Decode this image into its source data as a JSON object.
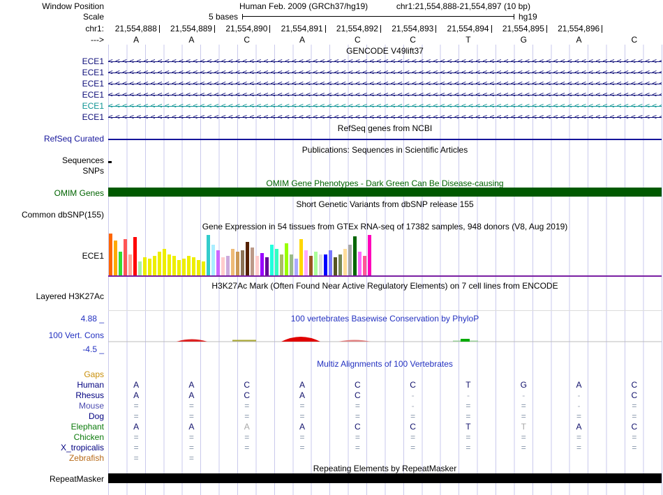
{
  "header": {
    "window_position_label": "Window Position",
    "assembly_title": "Human Feb. 2009 (GRCh37/hg19)",
    "position_text": "chr1:21,554,888-21,554,897 (10 bp)",
    "scale_label": "Scale",
    "scale_value": "5 bases",
    "scale_assembly": "hg19",
    "chrom_label": "chr1:",
    "strand_label": "--->",
    "coordinates": [
      "21,554,888",
      "21,554,889",
      "21,554,890",
      "21,554,891",
      "21,554,892",
      "21,554,893",
      "21,554,894",
      "21,554,895",
      "21,554,896"
    ],
    "bases": [
      "A",
      "A",
      "C",
      "A",
      "C",
      "C",
      "T",
      "G",
      "A",
      "C"
    ]
  },
  "tracks": {
    "gencode": {
      "title": "GENCODE V49lift37",
      "arrow_char": "<",
      "genes": [
        {
          "label": "ECE1",
          "color": "#0c0c78"
        },
        {
          "label": "ECE1",
          "color": "#0c0c78"
        },
        {
          "label": "ECE1",
          "color": "#0c0c78"
        },
        {
          "label": "ECE1",
          "color": "#0c0c78"
        },
        {
          "label": "ECE1",
          "color": "#0d9494"
        },
        {
          "label": "ECE1",
          "color": "#0c0c78"
        }
      ]
    },
    "refseq": {
      "title": "RefSeq genes from NCBI",
      "label": "RefSeq Curated",
      "color": "#15159b"
    },
    "publications": {
      "title": "Publications: Sequences in Scientific Articles",
      "label": "Sequences"
    },
    "snps": {
      "label": "SNPs"
    },
    "omim": {
      "title": "OMIM Gene Phenotypes - Dark Green Can Be Disease-causing",
      "label": "OMIM Genes",
      "bar_color": "#005900",
      "text_color": "#006400"
    },
    "dbsnp": {
      "title": "Short Genetic Variants from dbSNP release 155",
      "label": "Common dbSNP(155)"
    },
    "gtex": {
      "title": "Gene Expression in 54 tissues from GTEx RNA-seq of 17382 samples, 948 donors (V8, Aug 2019)",
      "label": "ECE1",
      "baseline_color": "#7a1fa2",
      "bars": [
        {
          "c": "#FF6600",
          "h": 60
        },
        {
          "c": "#FFAA00",
          "h": 50
        },
        {
          "c": "#33DD33",
          "h": 34
        },
        {
          "c": "#FF5555",
          "h": 52
        },
        {
          "c": "#FFAA99",
          "h": 30
        },
        {
          "c": "#FF0000",
          "h": 55
        },
        {
          "c": "#AAEEAA",
          "h": 20
        },
        {
          "c": "#EEEE00",
          "h": 26
        },
        {
          "c": "#EEEE00",
          "h": 24
        },
        {
          "c": "#EEEE00",
          "h": 28
        },
        {
          "c": "#EEEE00",
          "h": 34
        },
        {
          "c": "#EEEE00",
          "h": 38
        },
        {
          "c": "#EEEE00",
          "h": 30
        },
        {
          "c": "#EEEE00",
          "h": 28
        },
        {
          "c": "#EEEE00",
          "h": 22
        },
        {
          "c": "#EEEE00",
          "h": 24
        },
        {
          "c": "#EEEE00",
          "h": 28
        },
        {
          "c": "#EEEE00",
          "h": 26
        },
        {
          "c": "#EEEE00",
          "h": 22
        },
        {
          "c": "#EEEE00",
          "h": 20
        },
        {
          "c": "#33CCCC",
          "h": 58
        },
        {
          "c": "#AAEEFF",
          "h": 44
        },
        {
          "c": "#CC66FF",
          "h": 36
        },
        {
          "c": "#FFCCCC",
          "h": 26
        },
        {
          "c": "#CCAADD",
          "h": 28
        },
        {
          "c": "#EEBB77",
          "h": 38
        },
        {
          "c": "#CC9955",
          "h": 34
        },
        {
          "c": "#8B7355",
          "h": 36
        },
        {
          "c": "#552200",
          "h": 48
        },
        {
          "c": "#BB9988",
          "h": 40
        },
        {
          "c": "#FFCCCC",
          "h": 28
        },
        {
          "c": "#9900FF",
          "h": 32
        },
        {
          "c": "#660099",
          "h": 26
        },
        {
          "c": "#22FFDD",
          "h": 44
        },
        {
          "c": "#33FFC2",
          "h": 38
        },
        {
          "c": "#AABB66",
          "h": 30
        },
        {
          "c": "#99FF00",
          "h": 46
        },
        {
          "c": "#99BB88",
          "h": 30
        },
        {
          "c": "#AAAAFF",
          "h": 24
        },
        {
          "c": "#FFD700",
          "h": 52
        },
        {
          "c": "#FFAAFF",
          "h": 36
        },
        {
          "c": "#995522",
          "h": 28
        },
        {
          "c": "#AAFF99",
          "h": 34
        },
        {
          "c": "#DDDDDD",
          "h": 30
        },
        {
          "c": "#0000FF",
          "h": 30
        },
        {
          "c": "#7777FF",
          "h": 36
        },
        {
          "c": "#555522",
          "h": 26
        },
        {
          "c": "#778855",
          "h": 30
        },
        {
          "c": "#FFDD99",
          "h": 38
        },
        {
          "c": "#AAAAAA",
          "h": 44
        },
        {
          "c": "#006600",
          "h": 56
        },
        {
          "c": "#FF66FF",
          "h": 34
        },
        {
          "c": "#FF5599",
          "h": 28
        },
        {
          "c": "#FF00BB",
          "h": 58
        }
      ]
    },
    "h3k27ac": {
      "title": "H3K27Ac Mark (Often Found Near Active Regulatory Elements) on 7 cell lines from ENCODE",
      "label": "Layered H3K27Ac"
    },
    "conservation": {
      "title": "100 vertebrates Basewise Conservation by PhyloP",
      "label": "100 Vert. Cons",
      "max_label": "4.88 _",
      "min_label": "-4.5 _"
    },
    "multiz": {
      "title": "Multiz Alignments of 100 Vertebrates",
      "rows": [
        {
          "label": "Gaps",
          "color": "#c98f0a",
          "cells": [
            "",
            "",
            "",
            "",
            "",
            "",
            "",
            "",
            "",
            ""
          ]
        },
        {
          "label": "Human",
          "color": "#000080",
          "cells": [
            "A",
            "A",
            "C",
            "A",
            "C",
            "C",
            "T",
            "G",
            "A",
            "C"
          ]
        },
        {
          "label": "Rhesus",
          "color": "#000080",
          "cells": [
            "A",
            "A",
            "C",
            "A",
            "C",
            "-",
            "-",
            "-",
            "-",
            "C"
          ]
        },
        {
          "label": "Mouse",
          "color": "#4c4cb0",
          "cells": [
            "=",
            "=",
            "=",
            "=",
            "=",
            "-",
            "=",
            "=",
            "-",
            "="
          ]
        },
        {
          "label": "Dog",
          "color": "#000080",
          "cells": [
            "=",
            "=",
            "=",
            "=",
            "=",
            "=",
            "=",
            "=",
            "=",
            "="
          ]
        },
        {
          "label": "Elephant",
          "color": "#0a7a0a",
          "cells": [
            "A",
            "A",
            "~A",
            "A",
            "C",
            "C",
            "T",
            "~T",
            "A",
            "C"
          ]
        },
        {
          "label": "Chicken",
          "color": "#0a7a0a",
          "cells": [
            "=",
            "=",
            "=",
            "=",
            "=",
            "=",
            "=",
            "=",
            "=",
            "="
          ]
        },
        {
          "label": "X_tropicalis",
          "color": "#000080",
          "cells": [
            "=",
            "=",
            "=",
            "=",
            "=",
            "=",
            "=",
            "=",
            "=",
            "="
          ]
        },
        {
          "label": "Zebrafish",
          "color": "#b86a18",
          "cells": [
            "=",
            "=",
            "",
            "",
            "",
            "",
            "",
            "",
            "",
            ""
          ]
        }
      ]
    },
    "repeatmasker": {
      "title": "Repeating Elements by RepeatMasker",
      "label": "RepeatMasker"
    }
  }
}
